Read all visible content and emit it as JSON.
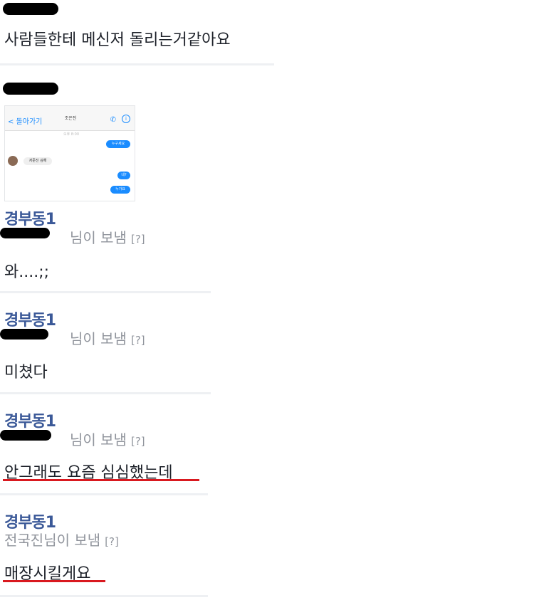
{
  "posts": [
    {
      "message": "사람들한테 메신저 돌리는거같아요"
    },
    {
      "thumbnail": {
        "back_label": "< 돌아가기",
        "title": "조은진",
        "time": "오후 8:00",
        "bubbles": [
          "누구세요",
          "저준진 김해",
          "네?",
          "누가요"
        ]
      }
    },
    {
      "name": "경부동1",
      "sender": "님이 보냄",
      "help": "[?]",
      "message": "와....;;"
    },
    {
      "name": "경부동1",
      "sender": "님이 보냄",
      "help": "[?]",
      "message": "미쳤다"
    },
    {
      "name": "경부동1",
      "sender": "님이 보냄",
      "help": "[?]",
      "message": "안그래도 요즘 심심했는데"
    },
    {
      "name": "경부동1",
      "sender": "전국진님이 보냄",
      "help": "[?]",
      "message": "매장시킬게요"
    }
  ],
  "colors": {
    "name": "#3b5998",
    "meta": "#90949c",
    "text": "#1d2129",
    "underline": "#d9191f",
    "divider": "#eef0f3",
    "redaction": "#000000"
  }
}
